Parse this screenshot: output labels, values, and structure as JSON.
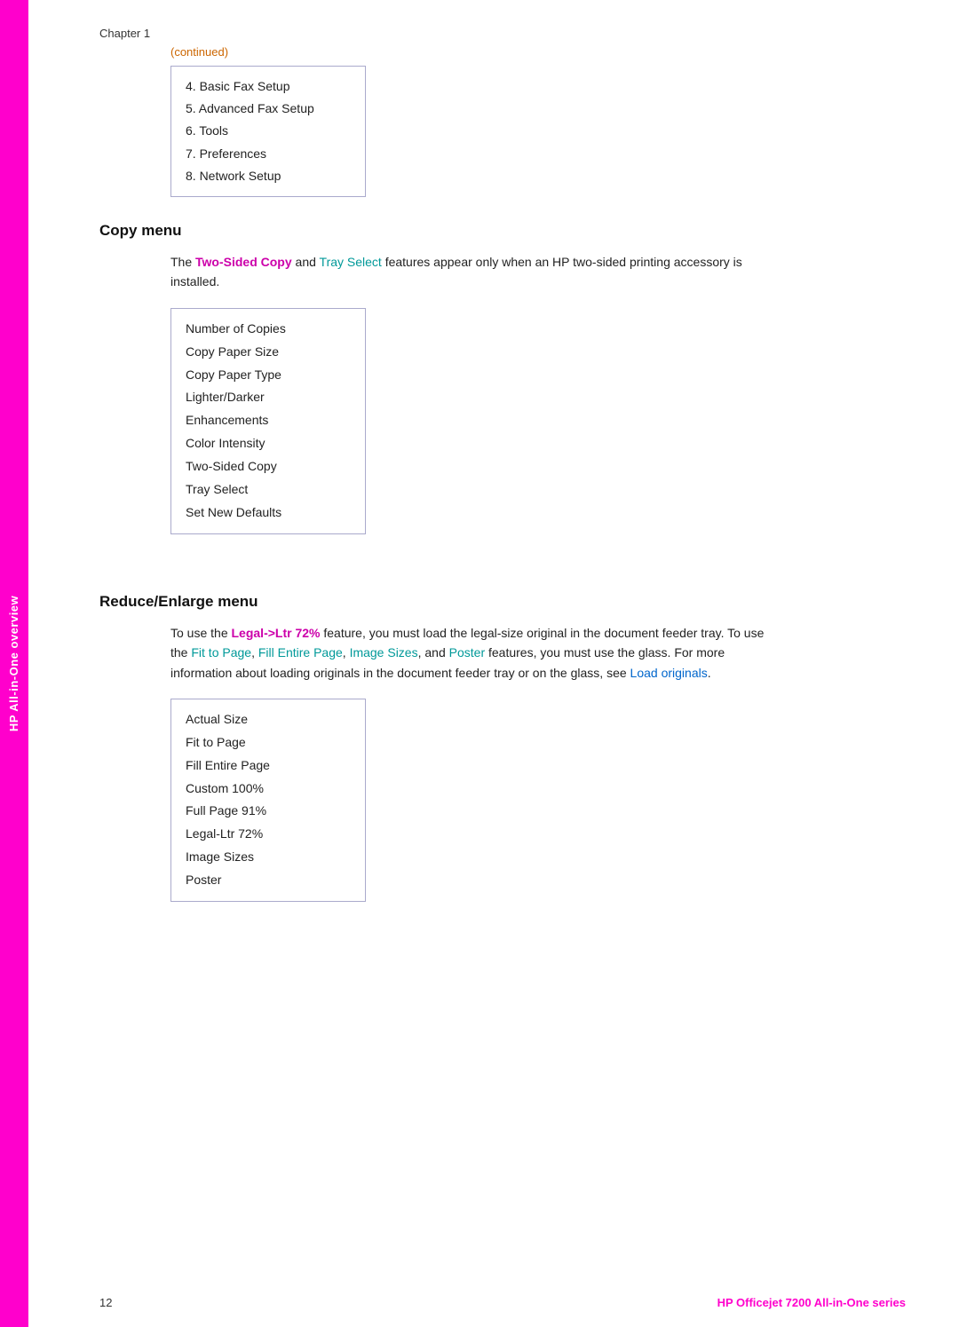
{
  "sidebar": {
    "label": "HP All-in-One overview"
  },
  "chapter": {
    "label": "Chapter 1",
    "continued": "(continued)"
  },
  "numbered_list": {
    "items": [
      "4. Basic Fax Setup",
      "5. Advanced Fax Setup",
      "6. Tools",
      "7. Preferences",
      "8. Network Setup"
    ]
  },
  "copy_menu": {
    "heading": "Copy menu",
    "intro_plain1": "The ",
    "intro_highlight1": "Two-Sided Copy",
    "intro_plain2": " and ",
    "intro_highlight2": "Tray Select",
    "intro_plain3": " features appear only when an HP two-sided printing accessory is installed.",
    "items": [
      "Number of Copies",
      "Copy Paper Size",
      "Copy Paper Type",
      "Lighter/Darker",
      "Enhancements",
      "Color Intensity",
      "Two-Sided Copy",
      "Tray Select",
      "Set New Defaults"
    ]
  },
  "reduce_enlarge_menu": {
    "heading": "Reduce/Enlarge menu",
    "intro_plain1": "To use the ",
    "intro_highlight1": "Legal->Ltr 72%",
    "intro_plain2": " feature, you must load the legal-size original in the document feeder tray. To use the ",
    "intro_highlight2": "Fit to Page",
    "intro_plain3": ", ",
    "intro_highlight3": "Fill Entire Page",
    "intro_plain4": ", ",
    "intro_highlight4": "Image Sizes",
    "intro_plain5": ", and ",
    "intro_highlight5": "Poster",
    "intro_plain6": " features, you must use the glass. For more information about loading originals in the document feeder tray or on the glass, see ",
    "intro_link": "Load originals",
    "intro_plain7": ".",
    "items": [
      "Actual Size",
      "Fit to Page",
      "Fill Entire Page",
      "Custom 100%",
      "Full Page 91%",
      "Legal-Ltr 72%",
      "Image Sizes",
      "Poster"
    ]
  },
  "footer": {
    "page_number": "12",
    "product_name": "HP Officejet 7200 All-in-One series"
  }
}
